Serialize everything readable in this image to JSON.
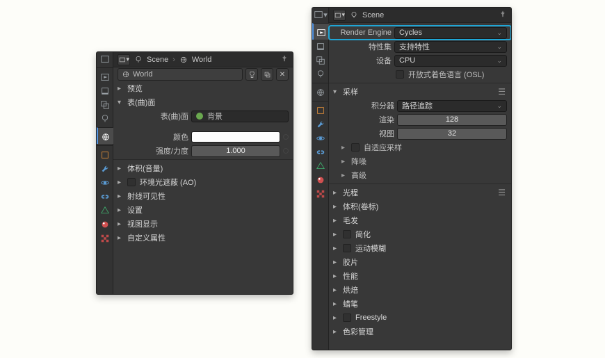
{
  "left": {
    "breadcrumb": {
      "scene": "Scene",
      "world": "World"
    },
    "world_id": "World",
    "sections": {
      "preview": "预览",
      "surface": "表(曲)面",
      "volume": "体积(音量)",
      "ao": "环境光遮蔽 (AO)",
      "ray": "射线可见性",
      "settings": "设置",
      "viewport": "视图显示",
      "custom": "自定义属性"
    },
    "surface": {
      "label": "表(曲)面",
      "value": "背景",
      "dot": "#6aa84f",
      "color_label": "颜色",
      "strength_label": "强度/力度",
      "strength_value": "1.000"
    }
  },
  "right": {
    "breadcrumb": {
      "scene": "Scene"
    },
    "engine_label": "Render Engine",
    "engine_value": "Cycles",
    "feature_label": "特性集",
    "feature_value": "支持特性",
    "device_label": "设备",
    "device_value": "CPU",
    "osl_label": "开放式着色语言 (OSL)",
    "sampling": {
      "title": "采样",
      "integrator_label": "积分器",
      "integrator_value": "路径追踪",
      "render_label": "渲染",
      "render_value": "128",
      "viewport_label": "视图",
      "viewport_value": "32",
      "adaptive": "自适应采样",
      "denoise": "降噪",
      "advanced": "高级"
    },
    "sections": {
      "lightpaths": "光程",
      "volumes": "体积(卷标)",
      "hair": "毛发",
      "simplify": "简化",
      "motionblur": "运动模糊",
      "film": "胶片",
      "performance": "性能",
      "bake": "烘焙",
      "grease": "蜡笔",
      "freestyle": "Freestyle",
      "colormgmt": "色彩管理"
    }
  }
}
